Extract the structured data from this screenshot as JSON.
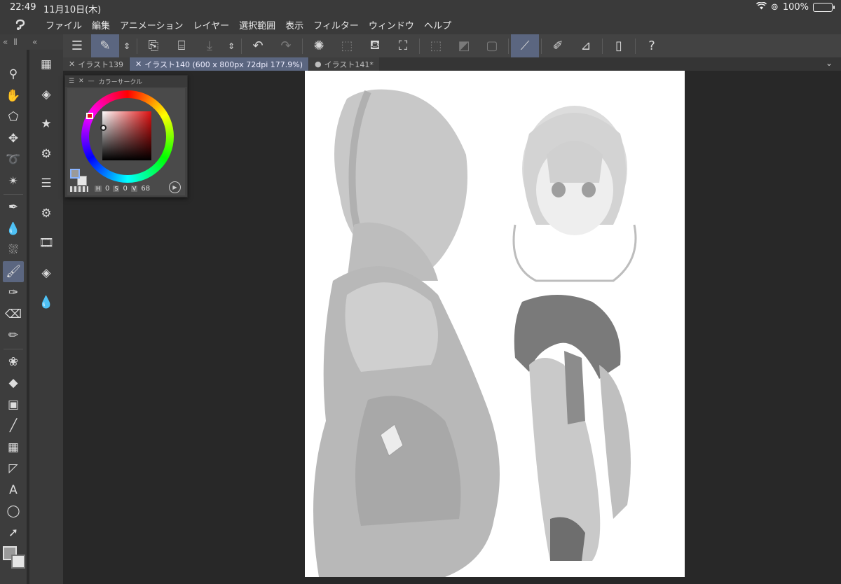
{
  "status_bar": {
    "time": "22:49",
    "date": "11月10日(木)",
    "battery": "100%"
  },
  "menu": {
    "items": [
      "ファイル",
      "編集",
      "アニメーション",
      "レイヤー",
      "選択範囲",
      "表示",
      "フィルター",
      "ウィンドウ",
      "ヘルプ"
    ]
  },
  "tabs": [
    {
      "label": "イラスト139",
      "closable": true,
      "active": false
    },
    {
      "label": "イラスト140 (600 x 800px 72dpi 177.9%)",
      "closable": true,
      "active": true
    },
    {
      "label": "イラスト141*",
      "closable": false,
      "active": false
    }
  ],
  "color_panel": {
    "title": "カラーサークル",
    "h_label": "H",
    "h_value": "0",
    "s_label": "S",
    "s_value": "0",
    "v_label": "V",
    "v_value": "68",
    "main_color": "#9a9a9a",
    "sub_color": "#e6e6e6",
    "hue_color": "#e01010"
  },
  "accent_color": "#5b6680"
}
